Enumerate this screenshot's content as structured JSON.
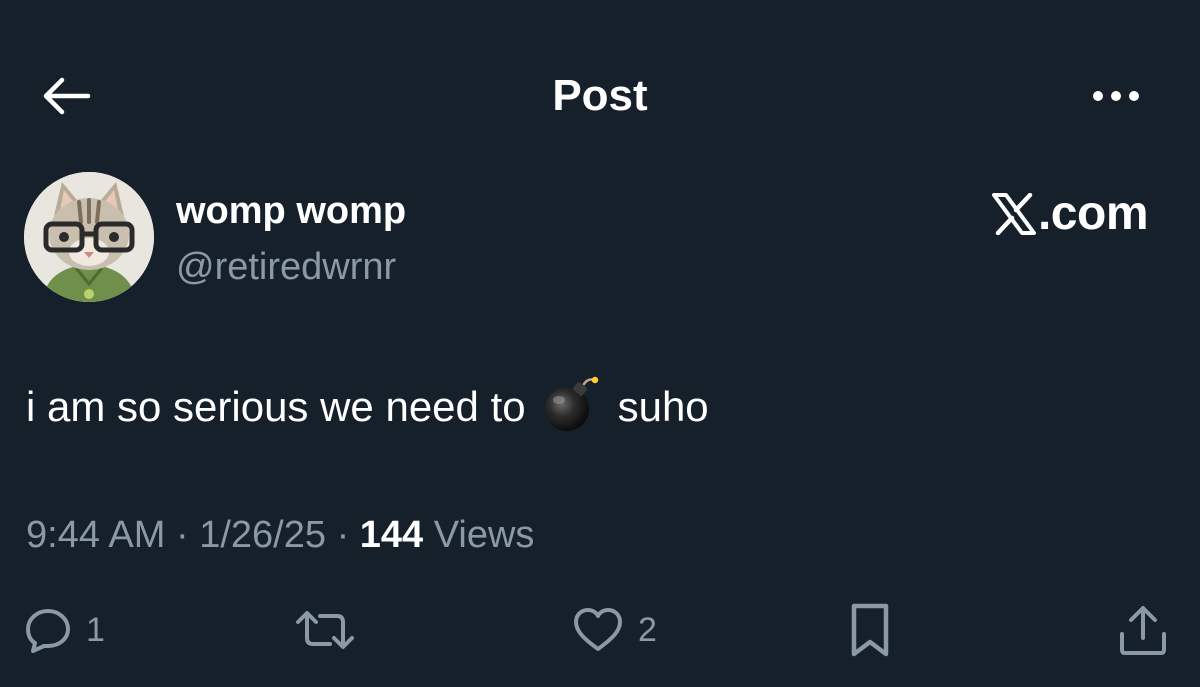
{
  "header": {
    "title": "Post",
    "back_icon": "arrow-left-icon",
    "more_icon": "more-horizontal-icon"
  },
  "author": {
    "display_name": "womp womp",
    "handle": "@retiredwrnr",
    "avatar": "cat-with-glasses-avatar"
  },
  "watermark": {
    "text": ".com",
    "logo": "x-logo-icon"
  },
  "post": {
    "text_before": "i am so serious we need to",
    "emoji": "bomb-emoji",
    "text_after": "suho"
  },
  "meta": {
    "time": "9:44 AM",
    "separator": "·",
    "date": "1/26/25",
    "views_count": "144",
    "views_label": "Views"
  },
  "actions": {
    "reply_count": "1",
    "like_count": "2",
    "reply_icon": "reply-icon",
    "repost_icon": "repost-icon",
    "like_icon": "heart-icon",
    "bookmark_icon": "bookmark-icon",
    "share_icon": "share-icon"
  },
  "colors": {
    "background": "#15202b",
    "text_primary": "#ffffff",
    "text_secondary": "#8b98a5"
  }
}
